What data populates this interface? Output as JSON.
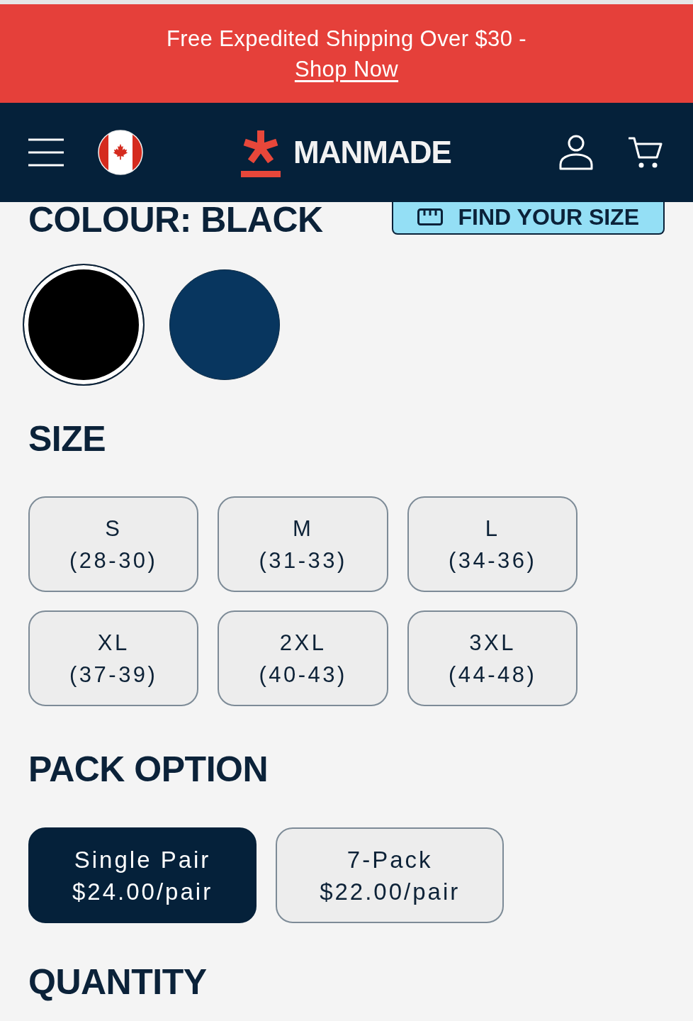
{
  "promo_banner": {
    "text": "Free Expedited Shipping Over $30 -",
    "link": "Shop Now"
  },
  "header": {
    "logo_text": "MANMADE"
  },
  "colour": {
    "label": "COLOUR: BLACK",
    "find_size_button": "FIND YOUR SIZE",
    "swatches": [
      {
        "color": "#000000",
        "selected": true
      },
      {
        "color": "#08365f",
        "selected": false
      }
    ]
  },
  "size": {
    "label": "SIZE",
    "options": [
      {
        "name": "S",
        "range": "(28-30)",
        "selected": false
      },
      {
        "name": "M",
        "range": "(31-33)",
        "selected": false
      },
      {
        "name": "L",
        "range": "(34-36)",
        "selected": false
      },
      {
        "name": "XL",
        "range": "(37-39)",
        "selected": false
      },
      {
        "name": "2XL",
        "range": "(40-43)",
        "selected": false
      },
      {
        "name": "3XL",
        "range": "(44-48)",
        "selected": false
      }
    ]
  },
  "pack": {
    "label": "PACK OPTION",
    "options": [
      {
        "name": "Single Pair",
        "price": "$24.00/pair",
        "selected": true
      },
      {
        "name": "7-Pack",
        "price": "$22.00/pair",
        "selected": false
      }
    ]
  },
  "quantity": {
    "label": "QUANTITY"
  }
}
